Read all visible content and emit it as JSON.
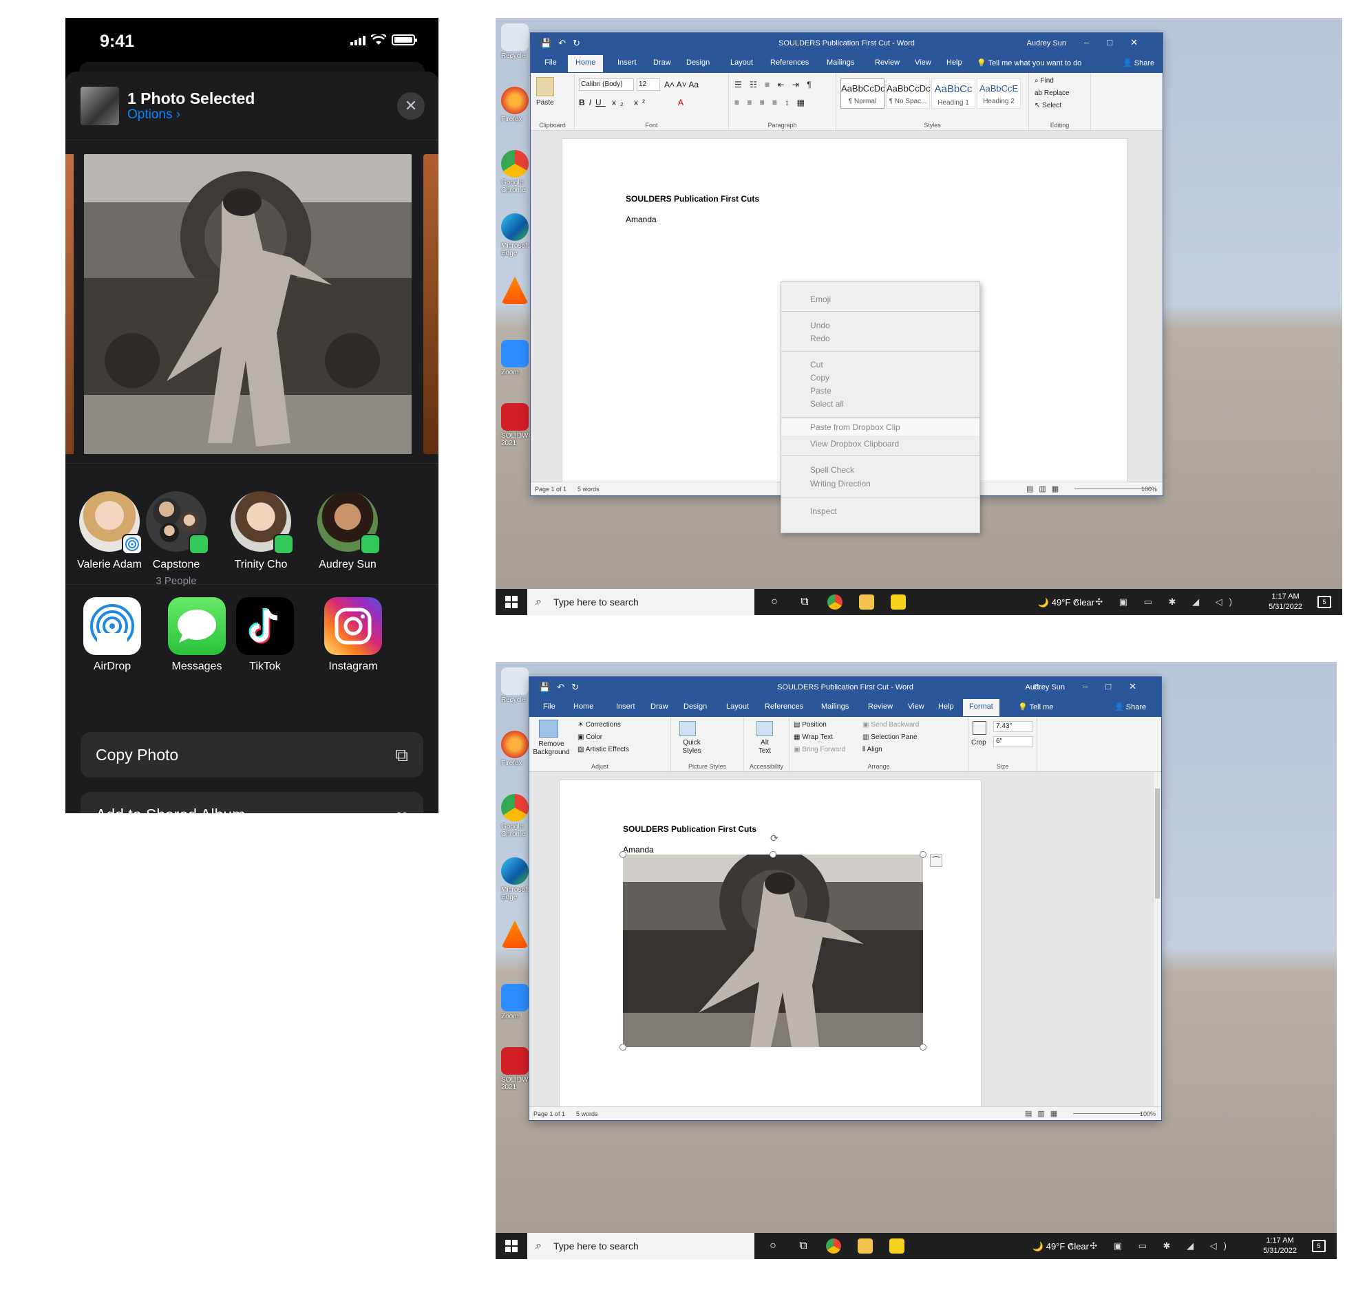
{
  "phone": {
    "status": {
      "time": "9:41"
    },
    "sheet": {
      "title": "1 Photo Selected",
      "options": "Options ›",
      "close_glyph": "✕"
    },
    "people": [
      {
        "name": "Valerie Adam",
        "sub": "",
        "badge": "airdrop"
      },
      {
        "name": "Capstone",
        "sub": "3 People",
        "badge": "messages"
      },
      {
        "name": "Trinity Cho",
        "sub": "",
        "badge": "messages"
      },
      {
        "name": "Audrey Sun",
        "sub": "",
        "badge": "messages"
      }
    ],
    "apps": [
      {
        "label": "AirDrop",
        "icon": "airdrop-icon"
      },
      {
        "label": "Messages",
        "icon": "messages-icon"
      },
      {
        "label": "TikTok",
        "icon": "tiktok-icon"
      },
      {
        "label": "Instagram",
        "icon": "instagram-icon"
      }
    ],
    "actions": [
      {
        "label": "Copy Photo",
        "icon": "copy-icon"
      },
      {
        "label": "Add to Shared Album",
        "icon": "shared-album-icon"
      }
    ]
  },
  "word1": {
    "title": "SOULDERS Publication First Cut  -  Word",
    "user": "Audrey Sun",
    "tabs": [
      "File",
      "Home",
      "Insert",
      "Draw",
      "Design",
      "Layout",
      "References",
      "Mailings",
      "Review",
      "View",
      "Help"
    ],
    "active_tab": "Home",
    "tell_me": "Tell me what you want to do",
    "share": "Share",
    "clipboard": {
      "paste": "Paste",
      "label": "Clipboard"
    },
    "font": {
      "name": "Calibri (Body)",
      "size": "12",
      "label": "Font"
    },
    "paragraph_label": "Paragraph",
    "styles": [
      {
        "sample": "AaBbCcDc",
        "name": "¶ Normal"
      },
      {
        "sample": "AaBbCcDc",
        "name": "¶ No Spac..."
      },
      {
        "sample": "AaBbCc",
        "name": "Heading 1"
      },
      {
        "sample": "AaBbCcE",
        "name": "Heading 2"
      }
    ],
    "styles_label": "Styles",
    "editing": {
      "find": "Find",
      "replace": "Replace",
      "select": "Select",
      "label": "Editing"
    },
    "doc_heading": "SOULDERS Publication First Cuts",
    "doc_name": "Amanda",
    "status": {
      "page": "Page 1 of 1",
      "words": "5 words",
      "zoom": "100%"
    },
    "context_menu": [
      [
        "Emoji"
      ],
      [
        "Undo",
        "Redo"
      ],
      [
        "Cut",
        "Copy",
        "Paste",
        "Select all"
      ],
      [
        "Paste from Dropbox Clip",
        "View Dropbox Clipboard"
      ],
      [
        "Spell Check",
        "Writing Direction"
      ],
      [
        "Inspect"
      ]
    ]
  },
  "word2": {
    "title": "SOULDERS Publication First Cut  -  Word",
    "user_prefix": "P...",
    "user": "Audrey Sun",
    "tabs": [
      "File",
      "Home",
      "Insert",
      "Draw",
      "Design",
      "Layout",
      "References",
      "Mailings",
      "Review",
      "View",
      "Help"
    ],
    "active_tab": "Format",
    "tell_me": "Tell me",
    "share": "Share",
    "adjust": {
      "remove_bg": "Remove Background",
      "corrections": "Corrections",
      "color": "Color",
      "artistic": "Artistic Effects",
      "label": "Adjust"
    },
    "picture_styles": {
      "quick": "Quick Styles",
      "label": "Picture Styles"
    },
    "accessibility": {
      "alt": "Alt Text",
      "label": "Accessibility"
    },
    "arrange": {
      "position": "Position",
      "wrap": "Wrap Text",
      "bring": "Bring Forward",
      "send": "Send Backward",
      "selection": "Selection Pane",
      "align": "Align",
      "label": "Arrange"
    },
    "size": {
      "crop": "Crop",
      "height": "7.43\"",
      "width": "6\"",
      "label": "Size"
    },
    "doc_heading": "SOULDERS Publication First Cuts",
    "doc_name": "Amanda",
    "status": {
      "page": "Page 1 of 1",
      "words": "5 words",
      "zoom": "100%"
    }
  },
  "desktop_icons": [
    "Recycle",
    "Firefox",
    "Google Chrome",
    "Microsoft Edge",
    "VLC media player",
    "Zoom",
    "SOLIDWORKS 2021"
  ],
  "taskbar": {
    "search_placeholder": "Type here to search",
    "weather": "49°F  Clear",
    "time": "1:17 AM",
    "date": "5/31/2022",
    "notifications": "5"
  }
}
